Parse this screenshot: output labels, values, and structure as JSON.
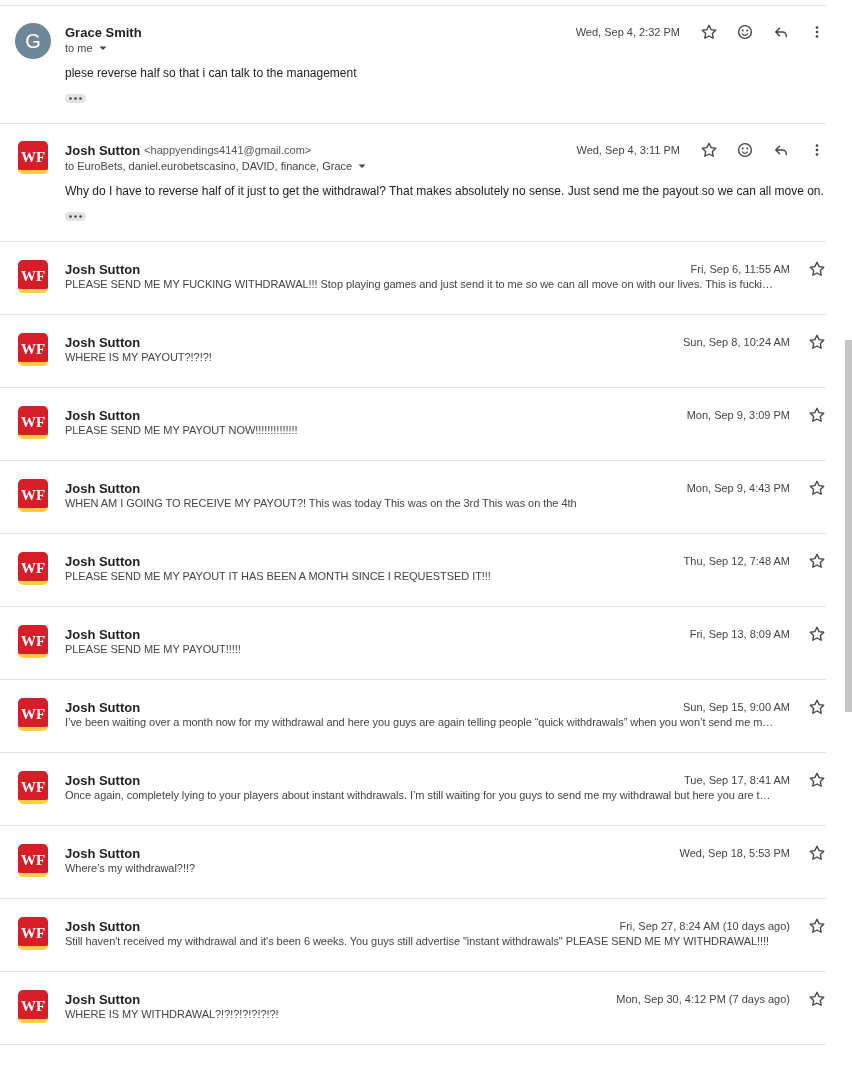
{
  "messages": [
    {
      "kind": "expanded",
      "sender": "Grace Smith",
      "avatar": {
        "kind": "letter",
        "text": "G"
      },
      "recipients": "to me",
      "date": "Wed, Sep 4, 2:32 PM",
      "starred": false,
      "body": "plese reverse half so that i can talk to the management"
    },
    {
      "kind": "expanded",
      "sender": "Josh Sutton",
      "address": "<happyendings4141@gmail.com>",
      "avatar": {
        "kind": "logo",
        "text": "WF"
      },
      "recipients": "to EuroBets, daniel.eurobetscasino, DAVID, finance, Grace",
      "date": "Wed, Sep 4, 3:11 PM",
      "starred": false,
      "body": "Why do I have to reverse half of it just to get the withdrawal? That makes absolutely no sense. Just send me the payout so we can all move on."
    },
    {
      "kind": "collapsed",
      "sender": "Josh Sutton",
      "avatar": {
        "kind": "logo",
        "text": "WF"
      },
      "date": "Fri, Sep 6, 11:55 AM",
      "starred": false,
      "snippet": "PLEASE SEND ME MY FUCKING WITHDRAWAL!!! Stop playing games and just send it to me so we can all move on with our lives. This is fucki…"
    },
    {
      "kind": "collapsed",
      "sender": "Josh Sutton",
      "avatar": {
        "kind": "logo",
        "text": "WF"
      },
      "date": "Sun, Sep 8, 10:24 AM",
      "starred": false,
      "snippet": "WHERE IS MY PAYOUT?!?!?!"
    },
    {
      "kind": "collapsed",
      "sender": "Josh Sutton",
      "avatar": {
        "kind": "logo",
        "text": "WF"
      },
      "date": "Mon, Sep 9, 3:09 PM",
      "starred": false,
      "snippet": "PLEASE SEND ME MY PAYOUT NOW!!!!!!!!!!!!!!"
    },
    {
      "kind": "collapsed",
      "sender": "Josh Sutton",
      "avatar": {
        "kind": "logo",
        "text": "WF"
      },
      "date": "Mon, Sep 9, 4:43 PM",
      "starred": false,
      "snippet": "WHEN AM I GOING TO RECEIVE MY PAYOUT?! This was today This was on the 3rd This was on the 4th"
    },
    {
      "kind": "collapsed",
      "sender": "Josh Sutton",
      "avatar": {
        "kind": "logo",
        "text": "WF"
      },
      "date": "Thu, Sep 12, 7:48 AM",
      "starred": false,
      "snippet": "PLEASE SEND ME MY PAYOUT IT HAS BEEN A MONTH SINCE I REQUESTSED IT!!!"
    },
    {
      "kind": "collapsed",
      "sender": "Josh Sutton",
      "avatar": {
        "kind": "logo",
        "text": "WF"
      },
      "date": "Fri, Sep 13, 8:09 AM",
      "starred": false,
      "snippet": "PLEASE SEND ME MY PAYOUT!!!!!"
    },
    {
      "kind": "collapsed",
      "sender": "Josh Sutton",
      "avatar": {
        "kind": "logo",
        "text": "WF"
      },
      "date": "Sun, Sep 15, 9:00 AM",
      "starred": false,
      "snippet": "I’ve been waiting over a month now for my withdrawal and here you guys are again telling people “quick withdrawals” when you won’t send me m…"
    },
    {
      "kind": "collapsed",
      "sender": "Josh Sutton",
      "avatar": {
        "kind": "logo",
        "text": "WF"
      },
      "date": "Tue, Sep 17, 8:41 AM",
      "starred": false,
      "snippet": "Once again, completely lying to your players about instant withdrawals. I’m still waiting for you guys to send me my withdrawal but here you are t…"
    },
    {
      "kind": "collapsed",
      "sender": "Josh Sutton",
      "avatar": {
        "kind": "logo",
        "text": "WF"
      },
      "date": "Wed, Sep 18, 5:53 PM",
      "starred": false,
      "snippet": "Where’s my withdrawal?!!?"
    },
    {
      "kind": "collapsed",
      "sender": "Josh Sutton",
      "avatar": {
        "kind": "logo",
        "text": "WF"
      },
      "date": "Fri, Sep 27, 8:24 AM (10 days ago)",
      "starred": false,
      "snippet": "Still haven't received my withdrawal and it's been 6 weeks. You guys still advertise \"instant withdrawals\" PLEASE SEND ME MY WITHDRAWAL!!!!"
    },
    {
      "kind": "collapsed",
      "sender": "Josh Sutton",
      "avatar": {
        "kind": "logo",
        "text": "WF"
      },
      "date": "Mon, Sep 30, 4:12 PM (7 days ago)",
      "starred": false,
      "snippet": "WHERE IS MY WITHDRAWAL?!?!?!?!?!?!?!"
    }
  ]
}
